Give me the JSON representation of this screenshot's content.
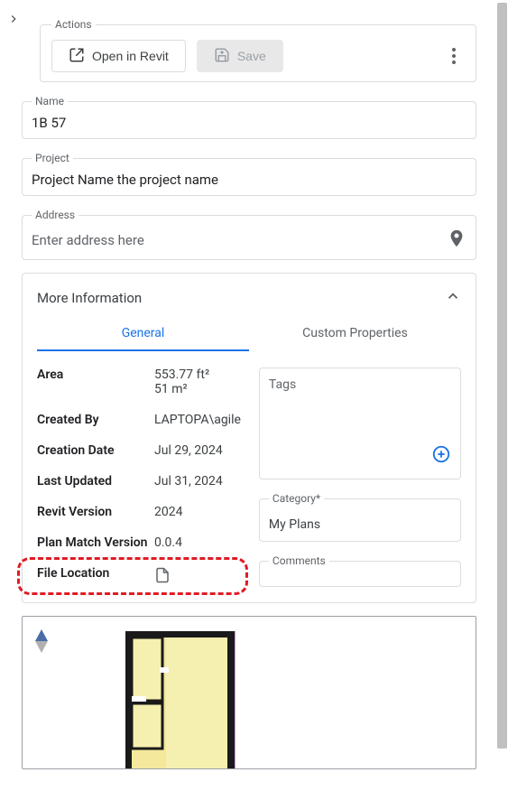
{
  "actions": {
    "legend": "Actions",
    "open_label": "Open in Revit",
    "save_label": "Save"
  },
  "fields": {
    "name": {
      "legend": "Name",
      "value": "1B 57"
    },
    "project": {
      "legend": "Project",
      "value": "Project Name the project name"
    },
    "address": {
      "legend": "Address",
      "placeholder": "Enter address here"
    }
  },
  "more_info": {
    "title": "More Information",
    "tabs": {
      "general": "General",
      "custom": "Custom Properties"
    },
    "rows": {
      "area": {
        "label": "Area",
        "value_ft": "553.77 ft²",
        "value_m": "51 m²"
      },
      "created_by": {
        "label": "Created By",
        "value": "LAPTOPA\\agile"
      },
      "creation_date": {
        "label": "Creation Date",
        "value": "Jul 29, 2024"
      },
      "last_updated": {
        "label": "Last Updated",
        "value": "Jul 31, 2024"
      },
      "revit_version": {
        "label": "Revit Version",
        "value": "2024"
      },
      "plan_match_version": {
        "label": "Plan Match Version",
        "value": "0.0.4"
      },
      "file_location": {
        "label": "File Location"
      }
    },
    "side": {
      "tags_label": "Tags",
      "category_legend": "Category*",
      "category_value": "My Plans",
      "comments_legend": "Comments"
    }
  }
}
